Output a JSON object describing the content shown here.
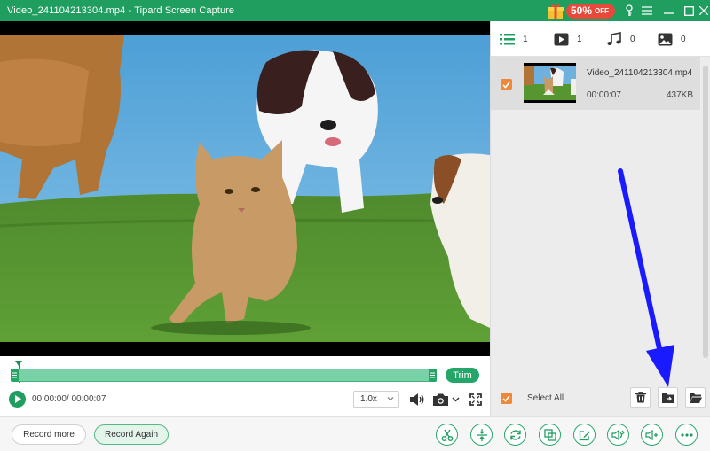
{
  "window": {
    "title": "Video_241104213304.mp4   -   Tipard Screen Capture",
    "promo_percent": "50%",
    "promo_suffix": "OFF"
  },
  "player": {
    "trim_label": "Trim",
    "time": "00:00:00/ 00:00:07",
    "speed": "1.0x",
    "playhead_progress": 0.0
  },
  "tabs": [
    {
      "icon": "list-icon",
      "count": "1"
    },
    {
      "icon": "video-icon",
      "count": "1"
    },
    {
      "icon": "music-icon",
      "count": "0"
    },
    {
      "icon": "image-icon",
      "count": "0"
    }
  ],
  "files": [
    {
      "name": "Video_241104213304.mp4",
      "duration": "00:00:07",
      "size": "437KB",
      "checked": true
    }
  ],
  "panel": {
    "select_all_label": "Select All"
  },
  "bottom": {
    "record_more_label": "Record more",
    "record_again_label": "Record Again"
  },
  "colors": {
    "brand_green": "#1f9e5f",
    "promo_red": "#e74a3b",
    "checkbox_orange": "#f0883a",
    "annotation_arrow": "#1a1aff"
  }
}
